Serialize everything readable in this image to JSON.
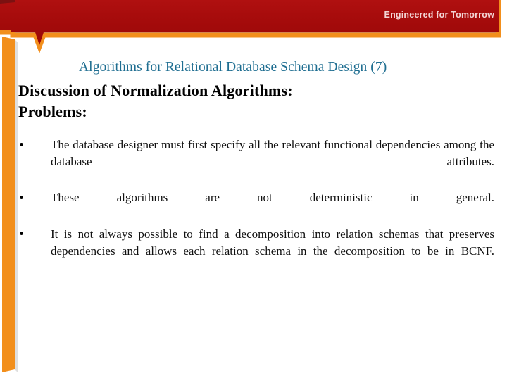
{
  "header": {
    "tagline": "Engineered for Tomorrow",
    "banner_color": "#a50b0b",
    "banner_highlight": "#c41111",
    "accent_color": "#f28f1c",
    "shadow_color": "#8a1b1b"
  },
  "slide": {
    "title": "Algorithms for Relational Database Schema Design (7)",
    "title_color": "#1f6e91",
    "heading_1": "Discussion of Normalization Algorithms:",
    "heading_2": "Problems:",
    "bullets": [
      "The database designer must first specify all the relevant functional dependencies among the database attributes.",
      "These algorithms are not deterministic in general.",
      "It is not always possible to find a decomposition into relation schemas that preserves dependencies and allows each relation schema in the decomposition to be in BCNF."
    ]
  }
}
